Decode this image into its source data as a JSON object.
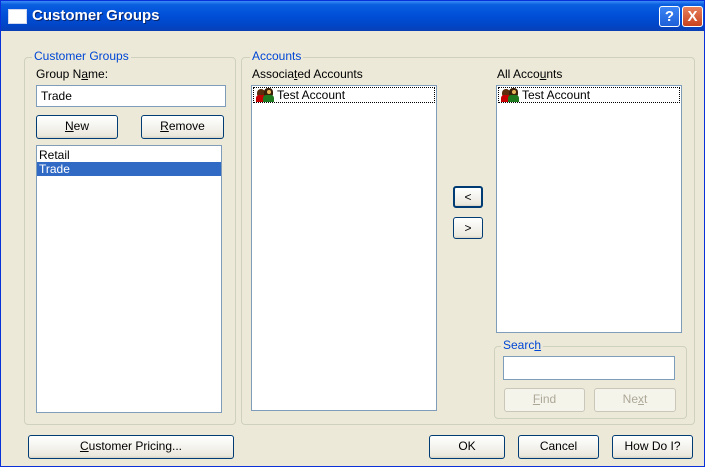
{
  "window": {
    "title": "Customer Groups",
    "help_label": "?",
    "close_label": "X"
  },
  "customer_groups": {
    "legend": "Customer Groups",
    "group_name_label": "Group Name:",
    "group_name_value": "Trade",
    "new_label": "New",
    "remove_label": "Remove",
    "groups": [
      "Retail",
      "Trade"
    ],
    "selected": "Trade"
  },
  "accounts": {
    "legend": "Accounts",
    "associated_label": "Associated Accounts",
    "associated_items": [
      "Test Account"
    ],
    "all_label": "All Accounts",
    "all_items": [
      "Test Account"
    ],
    "move_left_label": "<",
    "move_right_label": ">",
    "account_icon": "customer-people-icon"
  },
  "search": {
    "legend": "Search",
    "value": "",
    "find_label": "Find",
    "next_label": "Next"
  },
  "footer": {
    "customer_pricing_label": "Customer Pricing...",
    "ok_label": "OK",
    "cancel_label": "Cancel",
    "how_do_i_label": "How Do I?"
  },
  "colors": {
    "title_bar": "#0050d8",
    "dialog_bg": "#ece9d8",
    "legend_text": "#0046d5",
    "selection": "#316ac5"
  }
}
